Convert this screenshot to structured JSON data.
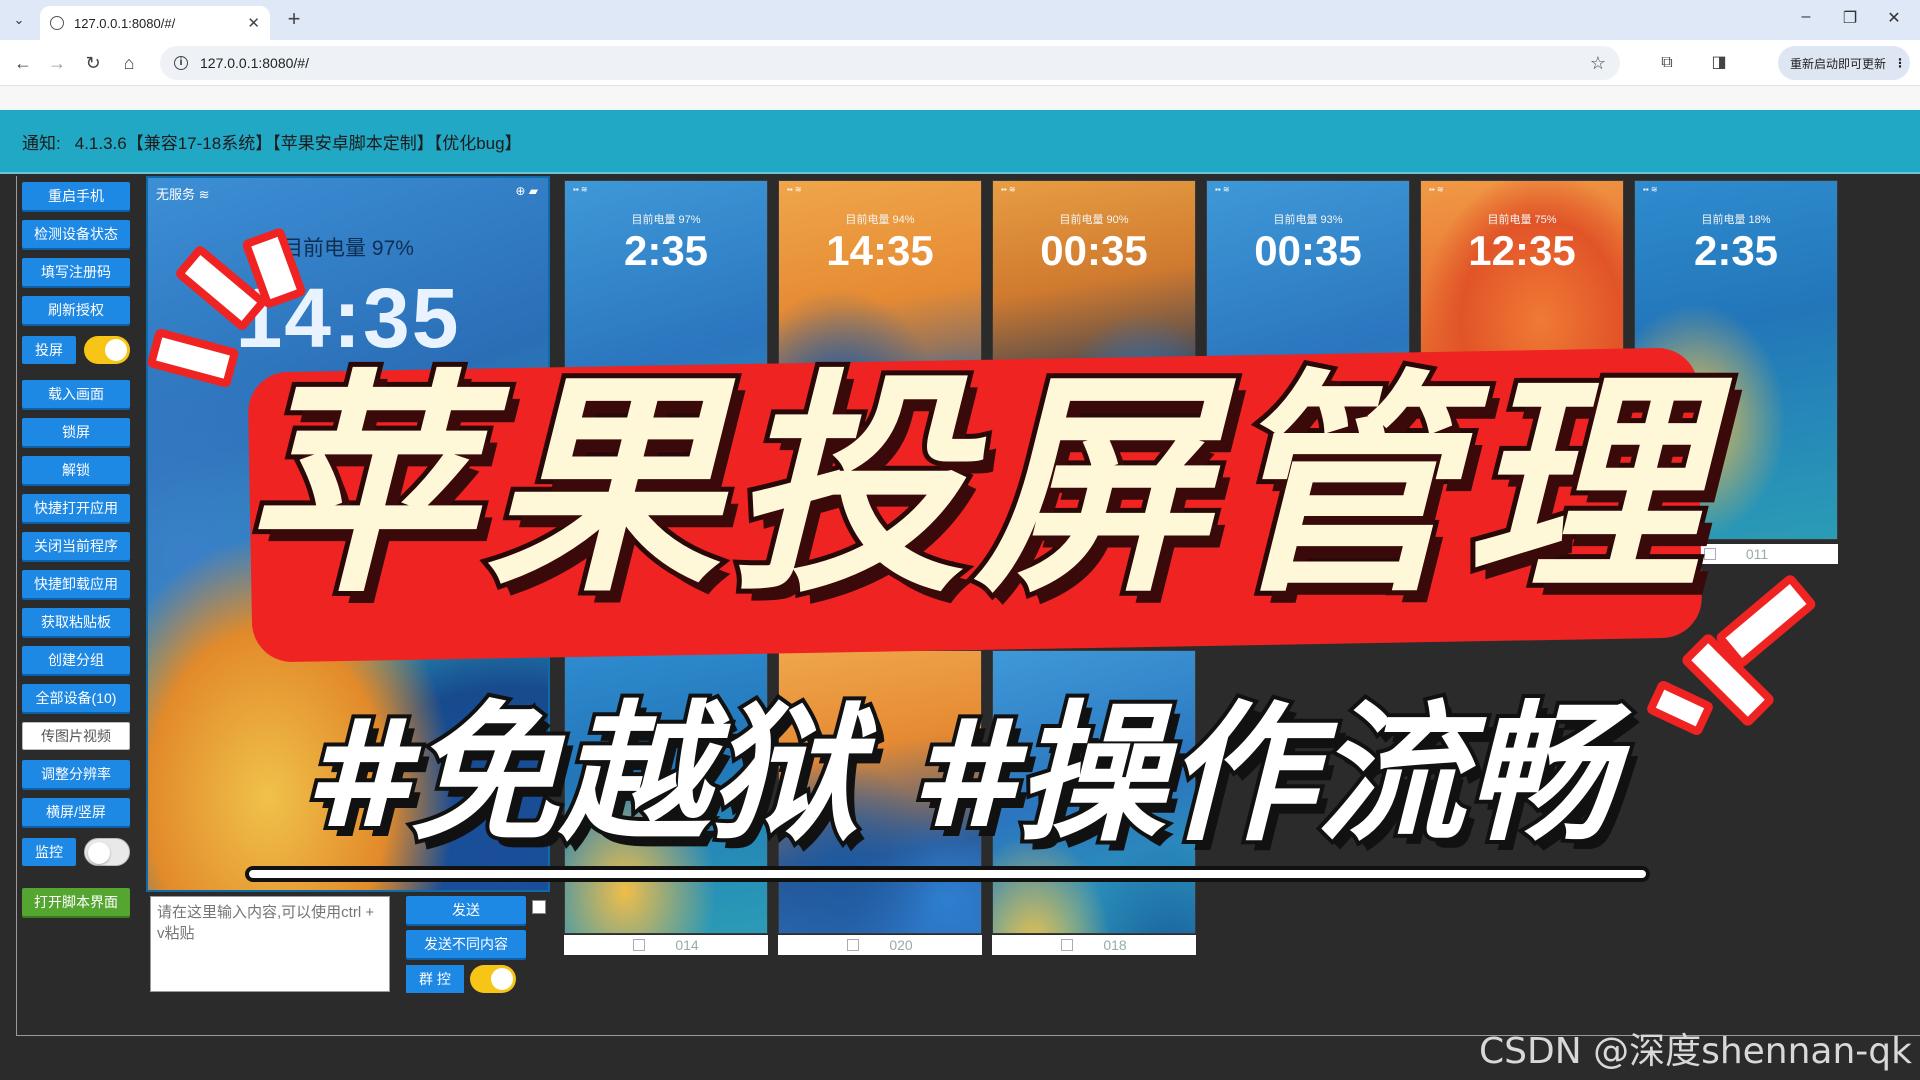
{
  "browser": {
    "tab_title": "127.0.0.1:8080/#/",
    "tab_close": "✕",
    "new_tab": "+",
    "url": "127.0.0.1:8080/#/",
    "update_button": "重新启动即可更新",
    "window_min": "–",
    "window_restore": "❐",
    "window_close": "✕"
  },
  "notice": {
    "label": "通知:",
    "text": "4.1.3.6【兼容17-18系统】【苹果安卓脚本定制】【优化bug】"
  },
  "sidebar": {
    "buttons": [
      "重启手机",
      "检测设备状态",
      "填写注册码",
      "刷新授权",
      "载入画面",
      "锁屏",
      "解锁",
      "快捷打开应用",
      "关闭当前程序",
      "快捷卸载应用",
      "获取粘贴板",
      "创建分组",
      "全部设备(10)",
      "传图片视频",
      "调整分辨率",
      "横屏/竖屏",
      "打开脚本界面"
    ],
    "screen_cast_label": "投屏",
    "screen_cast_on": true,
    "monitor_label": "监控",
    "monitor_on": false
  },
  "main_phone": {
    "carrier": "无服务",
    "battery_text": "目前电量 97%",
    "clock": "14:35"
  },
  "controls": {
    "input_placeholder": "请在这里输入内容,可以使用ctrl + v粘贴",
    "send_label": "发送",
    "send_different_label": "发送不同内容",
    "group_control_label": "群 控",
    "group_control_on": true
  },
  "thumbnails": [
    {
      "battery": "目前电量 97%",
      "clock": "2:35",
      "wallpaper": "blue"
    },
    {
      "battery": "目前电量 94%",
      "clock": "14:35",
      "wallpaper": "orange"
    },
    {
      "battery": "目前电量 90%",
      "clock": "00:35",
      "wallpaper": "dark"
    },
    {
      "battery": "目前电量 93%",
      "clock": "00:35",
      "wallpaper": "blue"
    },
    {
      "battery": "目前电量 75%",
      "clock": "12:35",
      "wallpaper": "red"
    },
    {
      "battery": "目前电量 18%",
      "clock": "2:35",
      "wallpaper": "teal"
    }
  ],
  "thumbnail_labels": [
    "011",
    "014",
    "020",
    "018"
  ],
  "overlay": {
    "title": "苹果投屏管理",
    "subtitle": "#免越狱 #操作流畅"
  },
  "watermark": "CSDN @深度shennan-qk",
  "colors": {
    "notice_bar": "#21a8c5",
    "button_blue": "#1e88e5",
    "button_green": "#55a630",
    "toggle_on": "#f7c515",
    "overlay_red": "#f02323"
  }
}
